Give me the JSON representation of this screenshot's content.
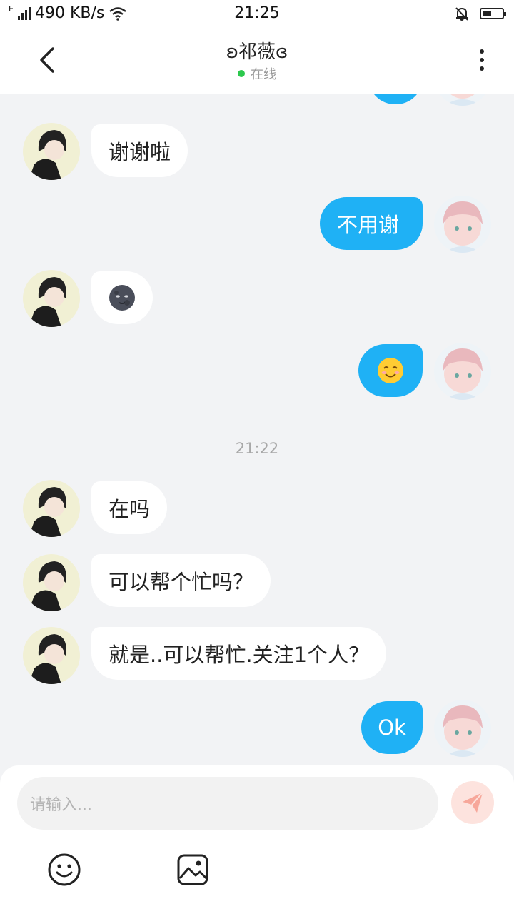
{
  "status_bar": {
    "network_type": "E",
    "speed": "490 KB/s",
    "time": "21:25",
    "battery_level": 0.45
  },
  "header": {
    "title": "ʚ祁薇ɞ",
    "status": "在线"
  },
  "messages": [
    {
      "side": "out",
      "text": ""
    },
    {
      "side": "in",
      "text": "谢谢啦"
    },
    {
      "side": "out",
      "text": "不用谢"
    },
    {
      "side": "in",
      "text": "🌚"
    },
    {
      "side": "out",
      "text": "😊"
    },
    {
      "side": "in",
      "text": "在吗"
    },
    {
      "side": "in",
      "text": "可以帮个忙吗？"
    },
    {
      "side": "in",
      "text": "就是..可以帮忙.关注1个人？"
    },
    {
      "side": "out",
      "text": "Ok"
    }
  ],
  "timestamp": "21:22",
  "input": {
    "placeholder": "请输入..."
  },
  "icons": {
    "back": "back-arrow-icon",
    "menu": "more-vertical-icon",
    "send": "send-icon",
    "emoji": "emoji-icon",
    "image": "image-icon"
  },
  "colors": {
    "outgoing_bubble": "#1fb1f5",
    "incoming_bubble": "#ffffff",
    "online_dot": "#2cc84d",
    "send_button": "#fde3de"
  }
}
